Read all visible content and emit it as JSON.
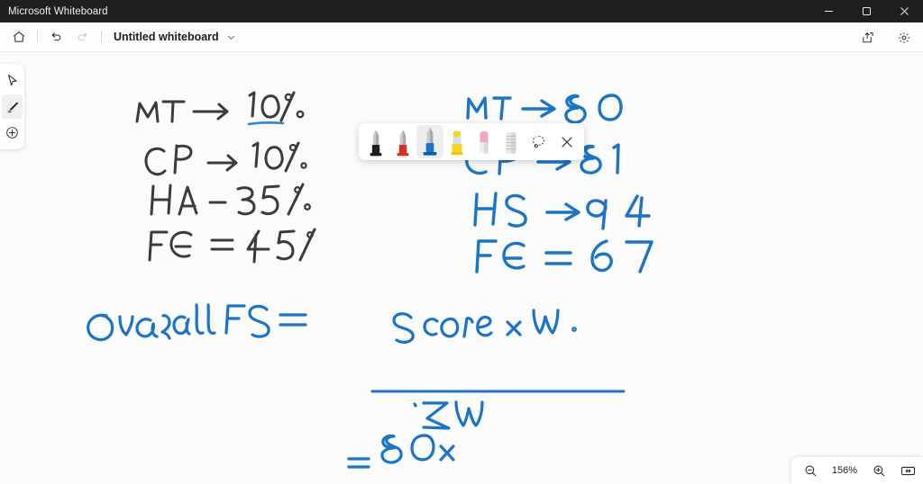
{
  "window": {
    "title": "Microsoft Whiteboard",
    "controls": [
      {
        "name": "minimize",
        "label": "─"
      },
      {
        "name": "maximize",
        "label": "□"
      },
      {
        "name": "close",
        "label": "✕"
      }
    ]
  },
  "toolbar": {
    "home_label": "Home",
    "undo_label": "Undo",
    "redo_label": "Redo",
    "document_title": "Untitled whiteboard",
    "title_chevron": "chevron-down",
    "share_label": "Share",
    "settings_label": "Settings"
  },
  "rail": {
    "items": [
      {
        "name": "select-tool",
        "label": "Select",
        "active": false
      },
      {
        "name": "pen-tool",
        "label": "Pen",
        "active": true
      },
      {
        "name": "insert-tool",
        "label": "Insert",
        "active": false
      }
    ]
  },
  "pen_toolbar": {
    "pens": [
      {
        "name": "pen-black",
        "label": "Black pen",
        "color": "#1b1b1b",
        "selected": false
      },
      {
        "name": "pen-red",
        "label": "Red pen",
        "color": "#d93025",
        "selected": false
      },
      {
        "name": "pen-blue",
        "label": "Blue pen",
        "color": "#1b74c4",
        "selected": true
      },
      {
        "name": "highlighter-yellow",
        "label": "Yellow highlighter",
        "color": "#f5d423",
        "selected": false
      }
    ],
    "eraser_label": "Eraser",
    "ruler_label": "Ruler",
    "lasso_label": "Lasso select",
    "close_label": "Close"
  },
  "canvas": {
    "background": "#fbfbfb",
    "ink_dark": "#3b3b3b",
    "ink_blue": "#1b74c4",
    "notes_left": [
      {
        "text": "MT → 10%",
        "underlined": true
      },
      {
        "text": "CP → 10%",
        "underlined": false
      },
      {
        "text": "HA - 35%",
        "underlined": false
      },
      {
        "text": "FE = 45%",
        "underlined": false
      }
    ],
    "notes_right": [
      {
        "text": "MT → 80"
      },
      {
        "text": "CP → 81"
      },
      {
        "text": "HS → 94"
      },
      {
        "text": "FE = 67"
      }
    ],
    "formula": {
      "lhs": "Overall FS =",
      "numerator": "Score x W .",
      "denominator": "ΣW",
      "result_equals": "=",
      "result": "80x"
    }
  },
  "zoom": {
    "out_label": "Zoom out",
    "level": "156%",
    "in_label": "Zoom in",
    "fit_label": "Fit to screen"
  }
}
